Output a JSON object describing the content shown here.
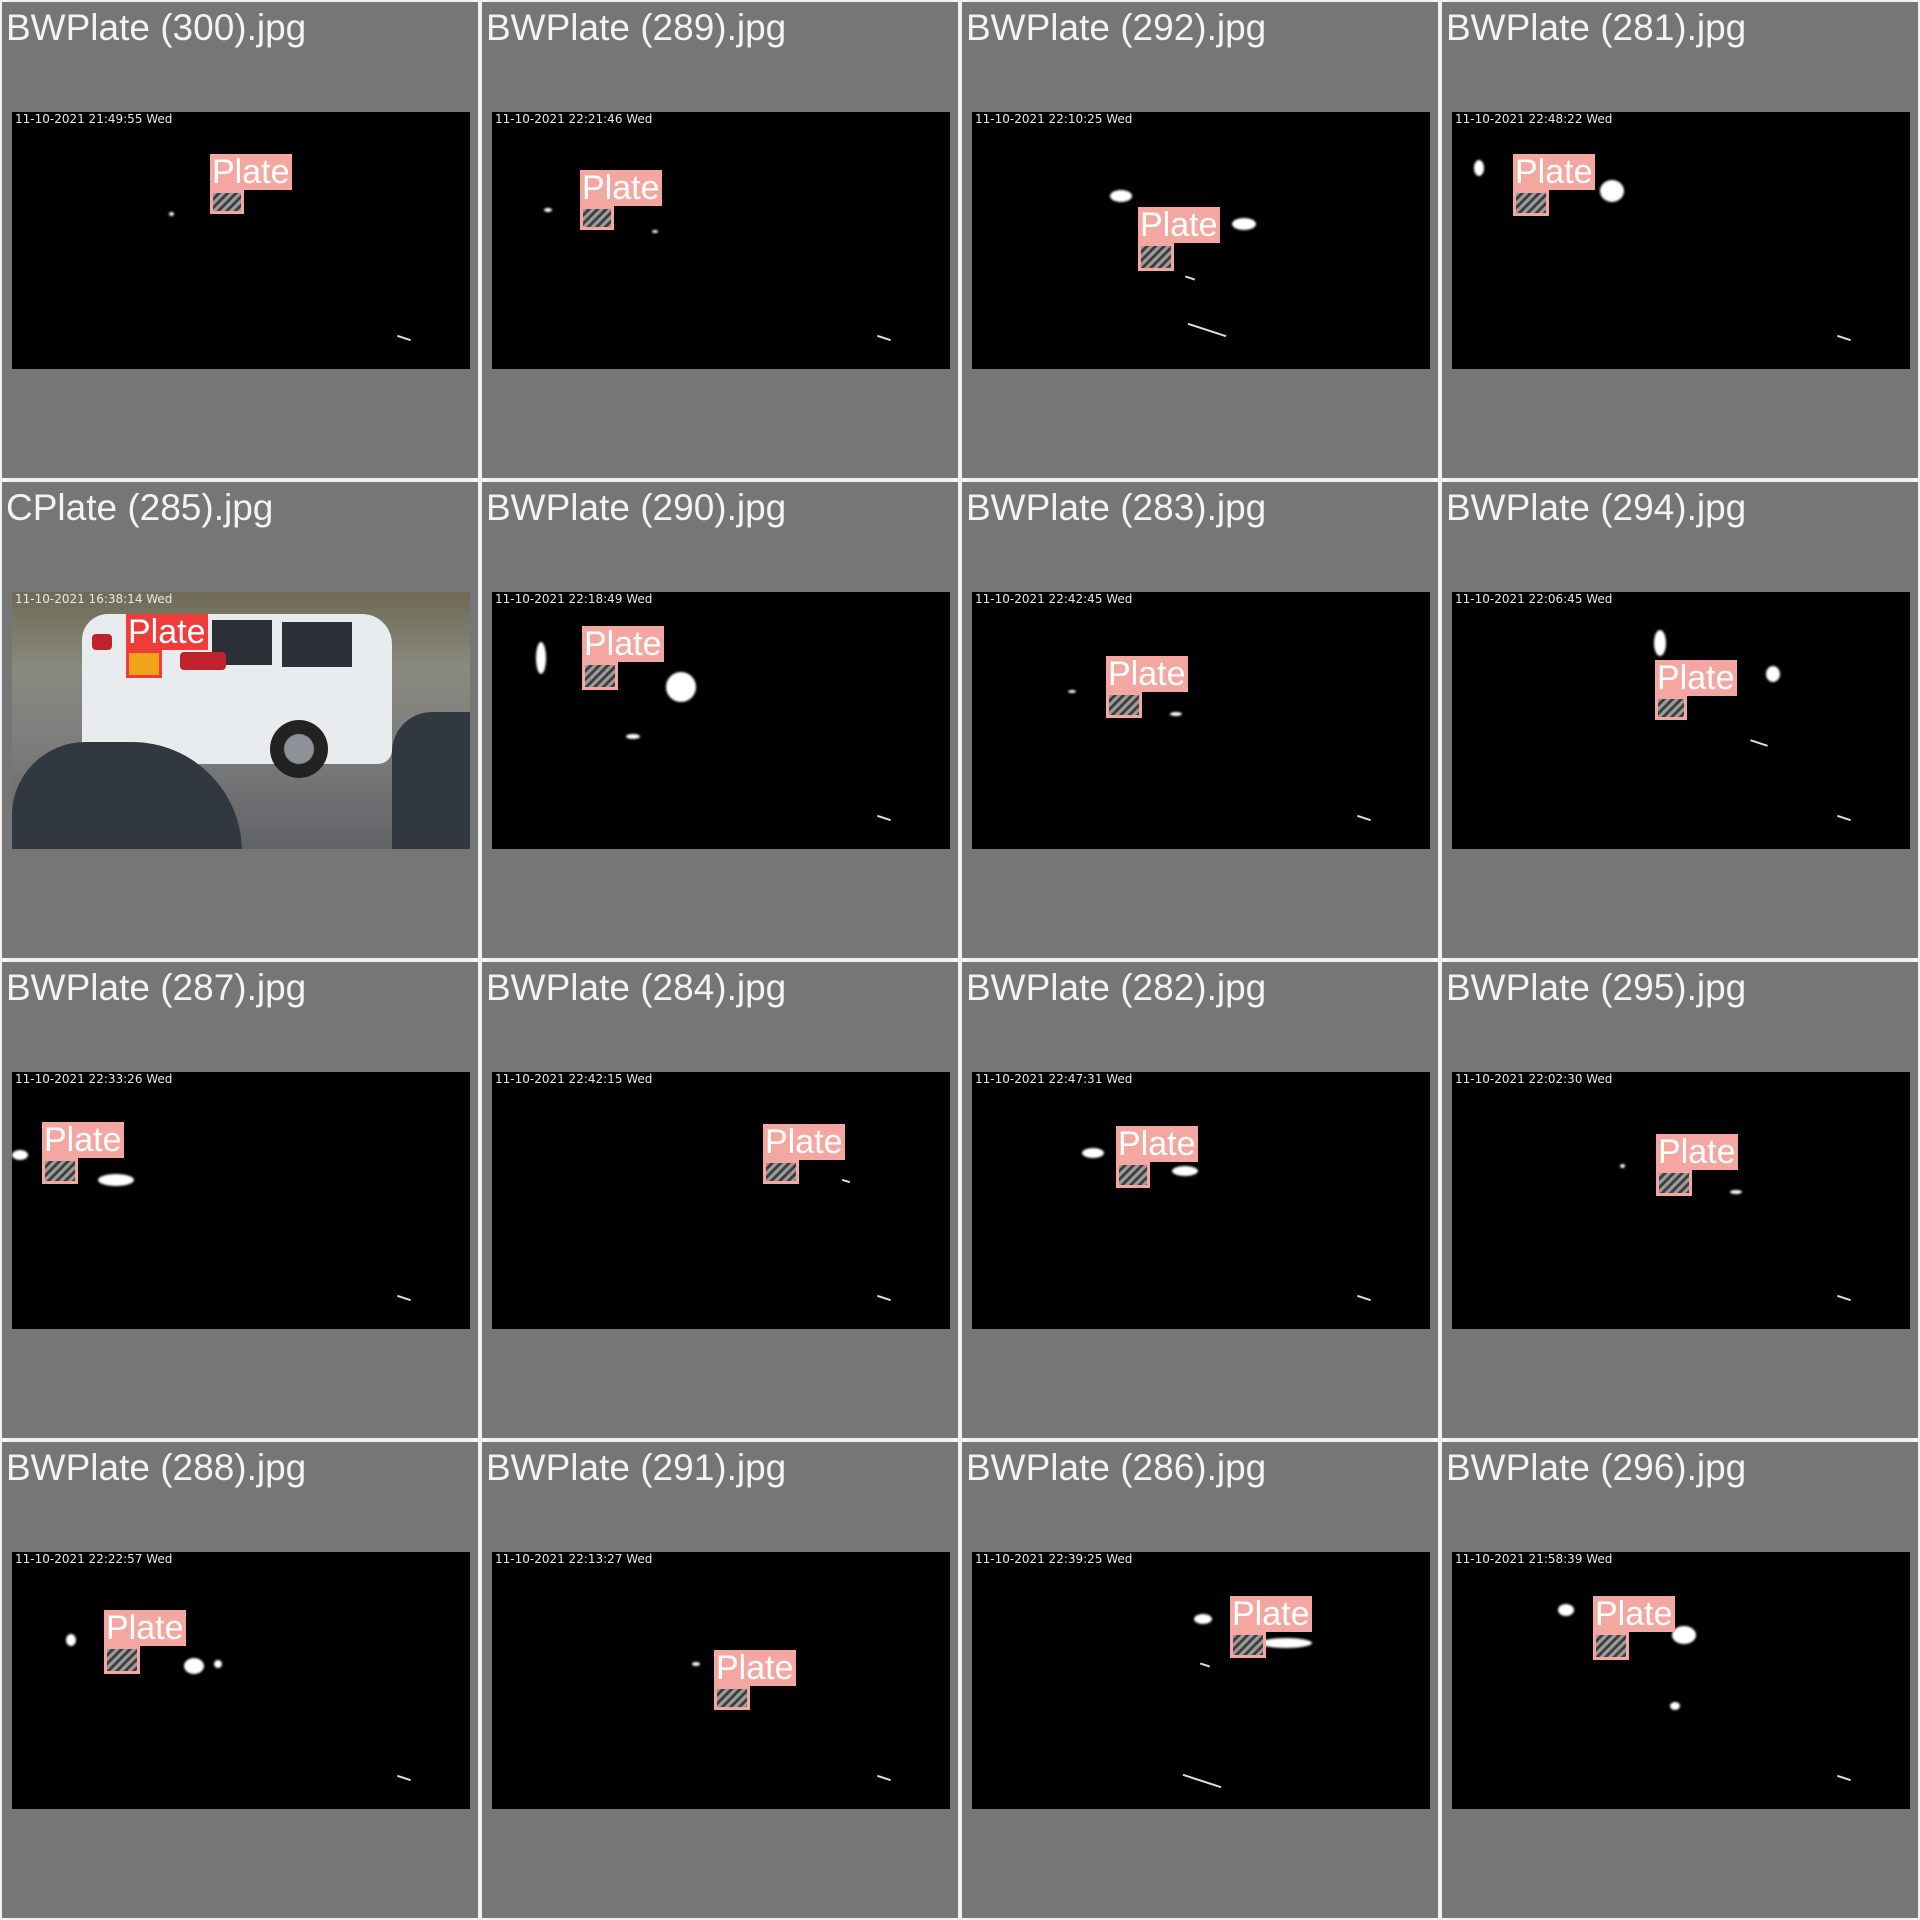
{
  "detection_label": "Plate",
  "colors": {
    "tile_background": "#767676",
    "frame_background": "#000000",
    "bw_box_color": "#f4a7a0",
    "color_box_color": "#f03b3b"
  },
  "tiles": [
    {
      "filename": "BWPlate (300).jpg",
      "timestamp": "11-10-2021 21:49:55 Wed"
    },
    {
      "filename": "BWPlate (289).jpg",
      "timestamp": "11-10-2021 22:21:46 Wed"
    },
    {
      "filename": "BWPlate (292).jpg",
      "timestamp": "11-10-2021 22:10:25 Wed"
    },
    {
      "filename": "BWPlate (281).jpg",
      "timestamp": "11-10-2021 22:48:22 Wed"
    },
    {
      "filename": "CPlate (285).jpg",
      "timestamp": "11-10-2021 16:38:14 Wed"
    },
    {
      "filename": "BWPlate (290).jpg",
      "timestamp": "11-10-2021 22:18:49 Wed"
    },
    {
      "filename": "BWPlate (283).jpg",
      "timestamp": "11-10-2021 22:42:45 Wed"
    },
    {
      "filename": "BWPlate (294).jpg",
      "timestamp": "11-10-2021 22:06:45 Wed"
    },
    {
      "filename": "BWPlate (287).jpg",
      "timestamp": "11-10-2021 22:33:26 Wed"
    },
    {
      "filename": "BWPlate (284).jpg",
      "timestamp": "11-10-2021 22:42:15 Wed"
    },
    {
      "filename": "BWPlate (282).jpg",
      "timestamp": "11-10-2021 22:47:31 Wed"
    },
    {
      "filename": "BWPlate (295).jpg",
      "timestamp": "11-10-2021 22:02:30 Wed"
    },
    {
      "filename": "BWPlate (288).jpg",
      "timestamp": "11-10-2021 22:22:57 Wed"
    },
    {
      "filename": "BWPlate (291).jpg",
      "timestamp": "11-10-2021 22:13:27 Wed"
    },
    {
      "filename": "BWPlate (286).jpg",
      "timestamp": "11-10-2021 22:39:25 Wed"
    },
    {
      "filename": "BWPlate (296).jpg",
      "timestamp": "11-10-2021 21:58:39 Wed"
    }
  ]
}
